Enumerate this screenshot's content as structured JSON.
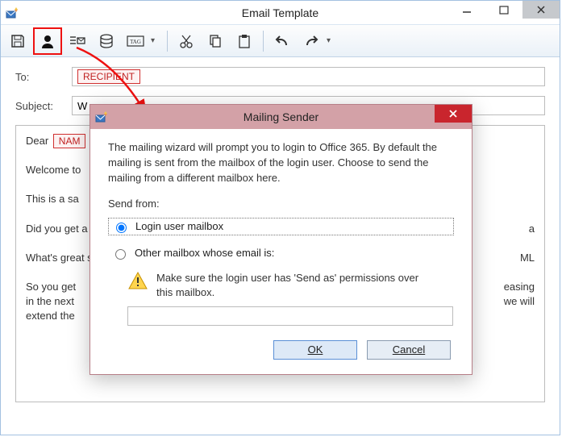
{
  "window": {
    "title": "Email Template"
  },
  "fields": {
    "to_label": "To:",
    "to_token": "RECIPIENT",
    "subject_label": "Subject:",
    "subject_value_prefix": "W"
  },
  "body": {
    "greeting_prefix": "Dear ",
    "greeting_token": "NAM",
    "p1": "Welcome to",
    "p2": "This is a sa",
    "p3": "Did you get a license might",
    "p4": "What's great support, be",
    "p5_a": "So you get",
    "p5_b": "in the next",
    "p5_c": "extend the",
    "p3_tail_a": "a",
    "p4_tail_a": "ML",
    "p5_tail_a": "easing",
    "p5_tail_b": "we will"
  },
  "dialog": {
    "title": "Mailing Sender",
    "description": "The mailing wizard will prompt you to login to Office 365. By default the mailing is sent from the mailbox of the login user. Choose to send the mailing from a different mailbox here.",
    "send_from_label": "Send from:",
    "opt_login": "Login user mailbox",
    "opt_other": "Other mailbox whose email is:",
    "warning": "Make sure the login user has 'Send as' permissions over this mailbox.",
    "other_email_value": "",
    "ok_label": "OK",
    "cancel_label": "Cancel"
  }
}
